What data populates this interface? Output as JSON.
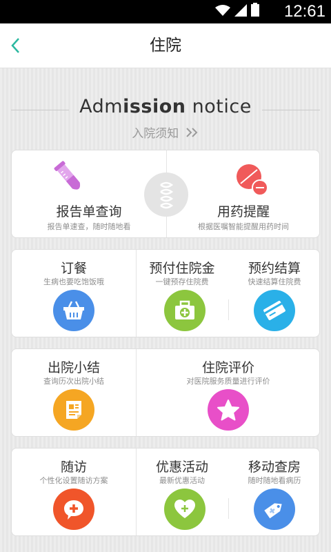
{
  "status_bar": {
    "time": "12:61"
  },
  "header": {
    "title": "住院"
  },
  "notice": {
    "en_prefix": "Adm",
    "en_bold": "ission",
    "en_suffix": " notice",
    "cn": "入院须知"
  },
  "card1": {
    "left": {
      "title": "报告单查询",
      "subtitle": "报告单速查，随时随地看",
      "icon": "test-tube-icon",
      "color": "#c86bd6"
    },
    "right": {
      "title": "用药提醒",
      "subtitle": "根据医嘱智能提醒用药时间",
      "icon": "pill-icon",
      "color": "#f05a5a"
    }
  },
  "card2": {
    "left": {
      "title": "订餐",
      "subtitle": "生病也要吃饱饭哦",
      "icon": "basket-icon",
      "color": "#4a8fe8"
    },
    "mid": {
      "title": "预付住院金",
      "subtitle": "一键预存住院费",
      "icon": "medical-kit-icon",
      "color": "#8cc63e"
    },
    "right": {
      "title": "预约结算",
      "subtitle": "快速结算住院费",
      "icon": "card-icon",
      "color": "#2ab0e8"
    }
  },
  "card3": {
    "left": {
      "title": "出院小结",
      "subtitle": "查询历次出院小结",
      "icon": "document-icon",
      "color": "#f5a623"
    },
    "right": {
      "title": "住院评价",
      "subtitle": "对医院服务质量进行评价",
      "icon": "star-icon",
      "color": "#e84fc8"
    }
  },
  "card4": {
    "left": {
      "title": "随访",
      "subtitle": "个性化设置随访方案",
      "icon": "chat-plus-icon",
      "color": "#f0552a"
    },
    "mid": {
      "title": "优惠活动",
      "subtitle": "最新优惠活动",
      "icon": "heart-plus-icon",
      "color": "#8cc63e"
    },
    "right": {
      "title": "移动查房",
      "subtitle": "随时随地看病历",
      "icon": "tag-icon",
      "color": "#4a8fe8"
    }
  }
}
